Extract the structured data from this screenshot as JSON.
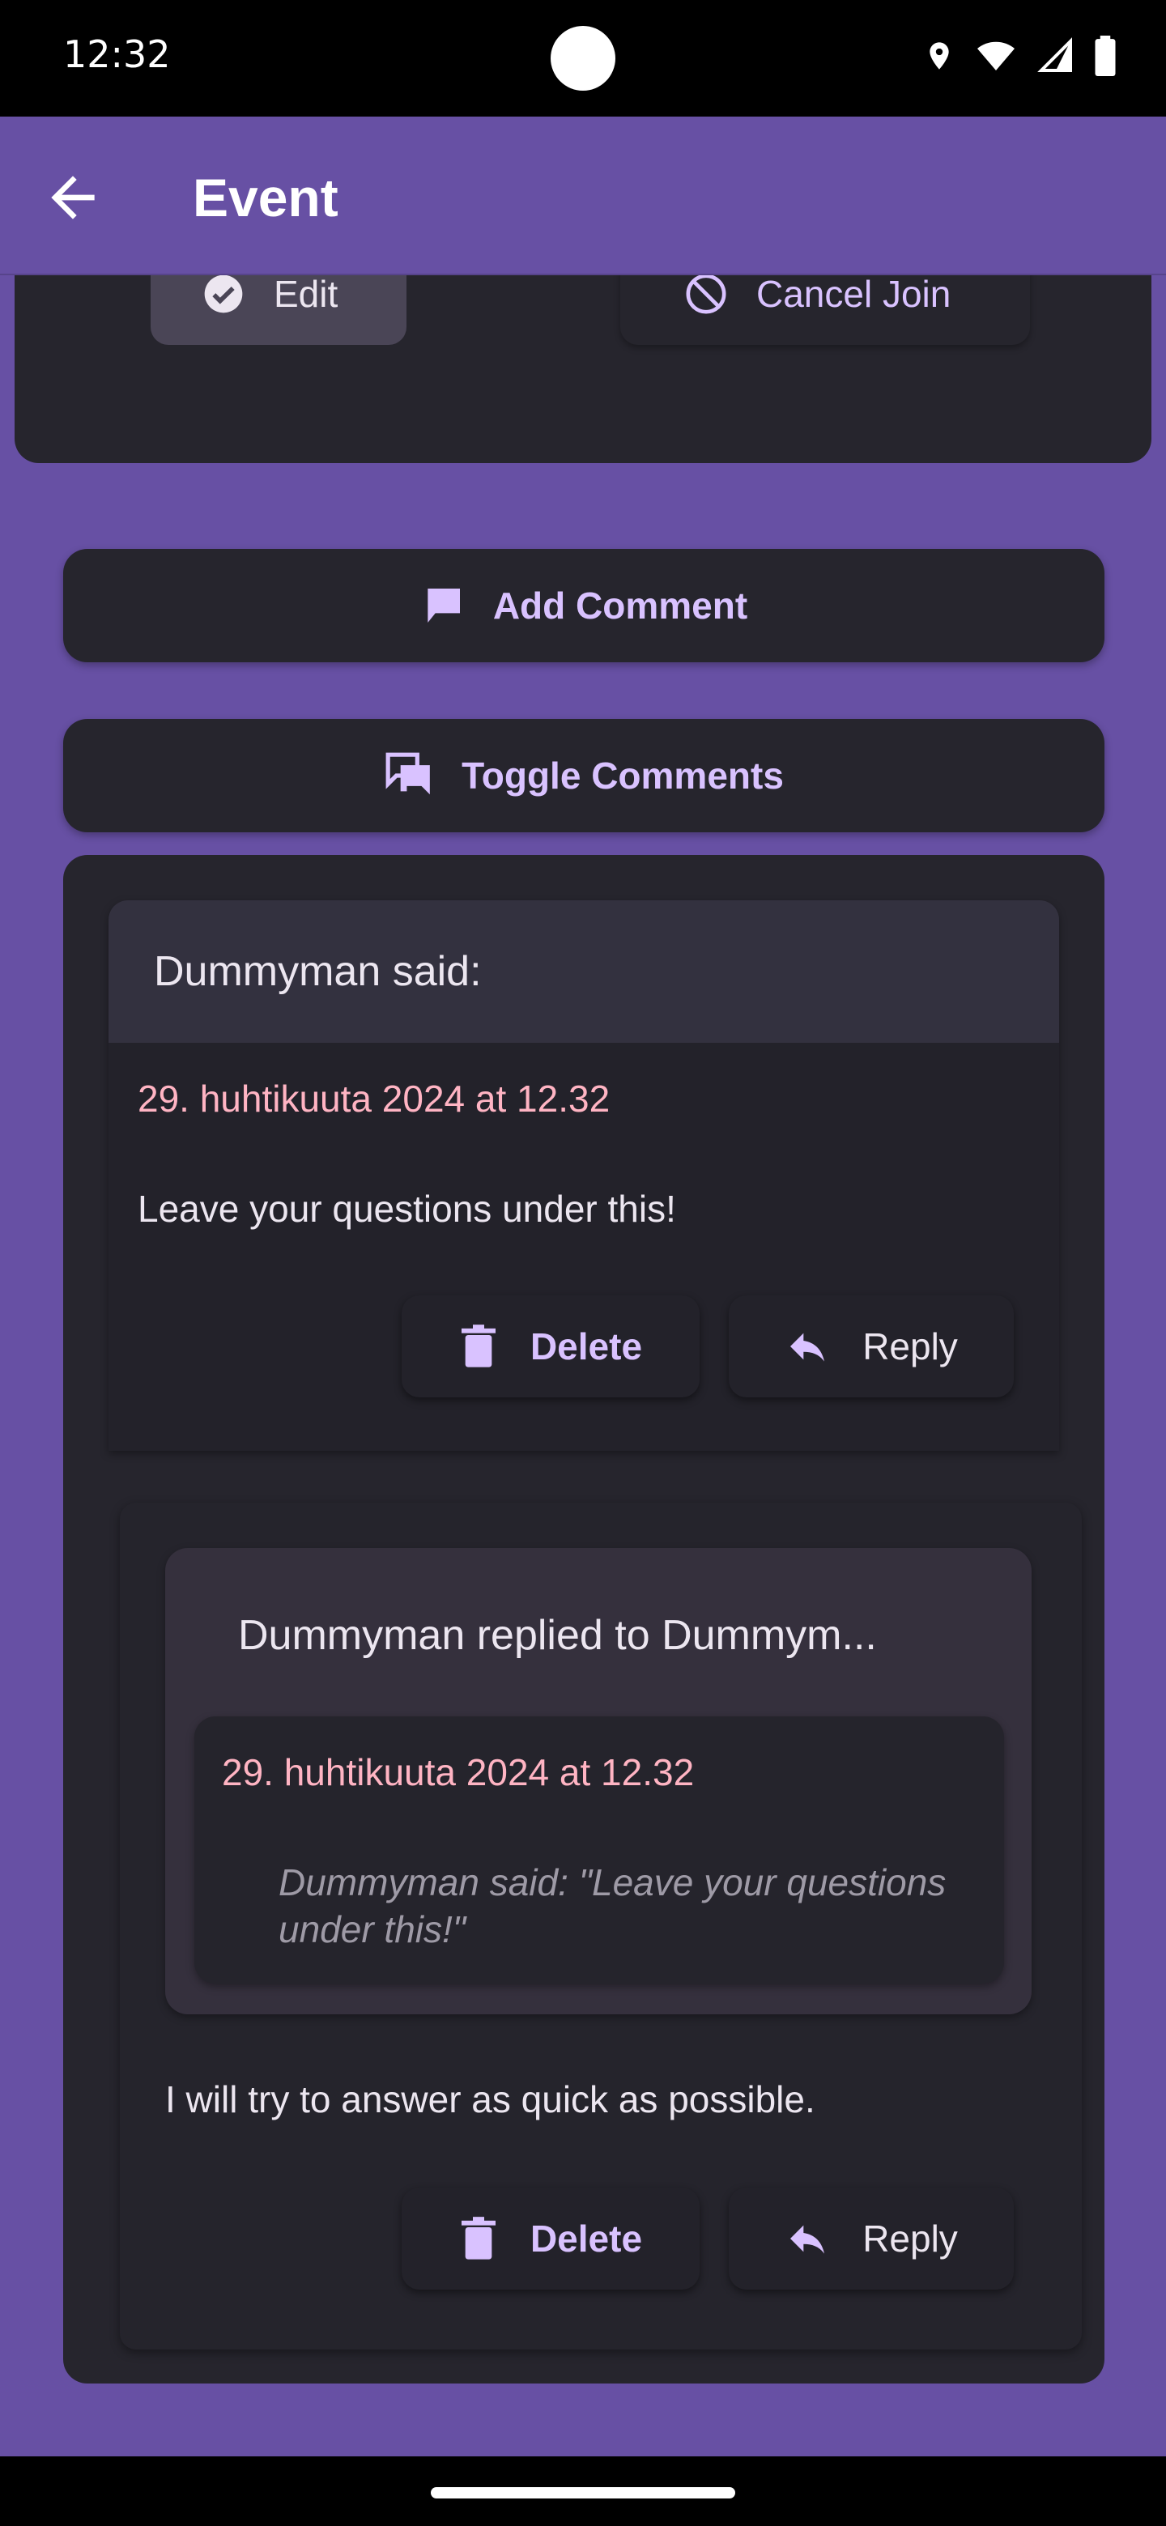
{
  "status_bar": {
    "time": "12:32"
  },
  "app_bar": {
    "title": "Event"
  },
  "event_actions": {
    "edit_label": "Edit",
    "cancel_join_label": "Cancel Join"
  },
  "add_comment_label": "Add Comment",
  "toggle_comments_label": "Toggle Comments",
  "comment": {
    "header": "Dummyman said:",
    "date": "29. huhtikuuta 2024 at 12.32",
    "text": "Leave your questions under this!",
    "delete_label": "Delete",
    "reply_label": "Reply"
  },
  "reply": {
    "header": "Dummyman replied to Dummym...",
    "quote_date": "29. huhtikuuta 2024 at 12.32",
    "quote_text": "Dummyman said: \"Leave your questions under this!\"",
    "text": "I will try to answer as quick as possible.",
    "delete_label": "Delete",
    "reply_label": "Reply"
  },
  "colors": {
    "primary": "#6750A4",
    "surface": "#26252d",
    "accent": "#d9c2ff",
    "date": "#ffb4c3"
  }
}
